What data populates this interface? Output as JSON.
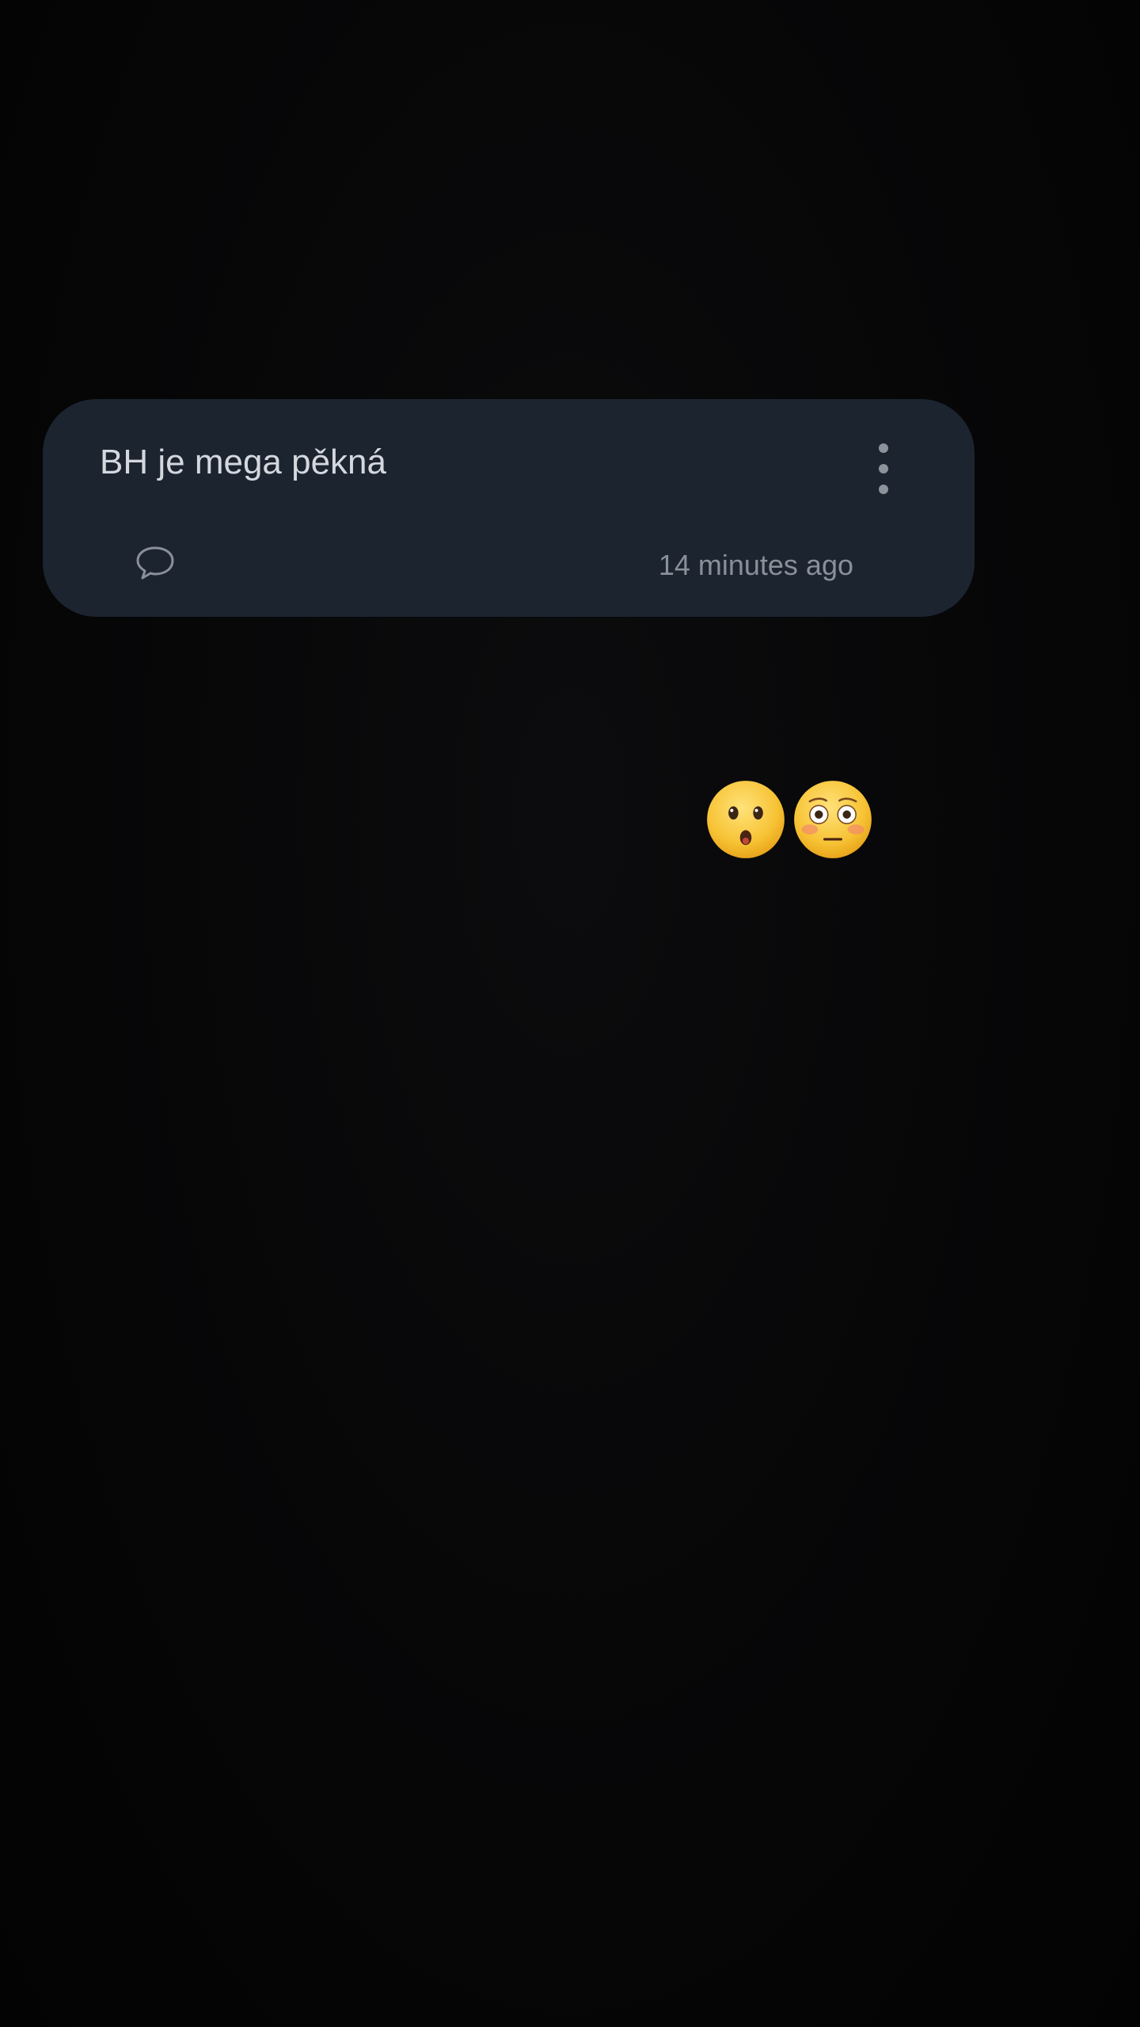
{
  "card": {
    "title": "BH je mega pěkná",
    "timestamp": "14 minutes ago",
    "menu_icon": "more-vertical-icon",
    "comment_icon": "comment-icon"
  },
  "reactions": {
    "items": [
      {
        "name": "hushed-face-emoji"
      },
      {
        "name": "flushed-face-emoji"
      }
    ]
  },
  "colors": {
    "background": "#050506",
    "card": "#1c2430",
    "title_text": "#d4d8de",
    "secondary_text": "#8a9099",
    "emoji_yellow": "#f7c335"
  }
}
